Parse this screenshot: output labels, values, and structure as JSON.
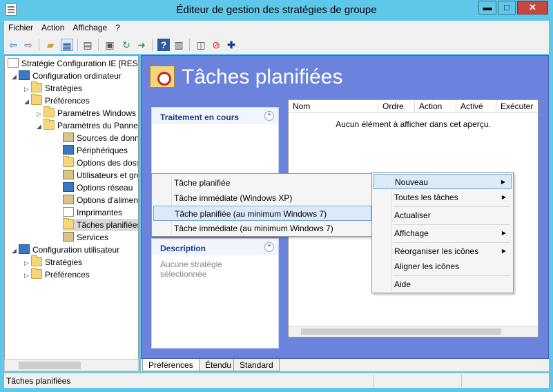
{
  "window": {
    "title": "Éditeur de gestion des stratégies de groupe",
    "minimize": "▬",
    "maximize": "□",
    "close": "✕"
  },
  "menubar": [
    "Fichier",
    "Action",
    "Affichage",
    "?"
  ],
  "toolbar_icons": [
    "back-icon",
    "forward-icon",
    "up-folder-icon",
    "show-hide-tree-icon",
    "properties-icon",
    "print-icon",
    "refresh-icon",
    "export-icon",
    "help-icon",
    "view-icon",
    "new-icon",
    "stop-icon",
    "add-icon"
  ],
  "tree": {
    "root": "Stratégie Configuration IE [RES-",
    "computer_config": "Configuration ordinateur",
    "strategies": "Stratégies",
    "preferences": "Préférences",
    "windows_params": "Paramètres Windows",
    "panel_params": "Paramètres du Panne",
    "data_sources": "Sources de donn",
    "devices": "Périphériques",
    "folder_options": "Options des doss",
    "users_groups": "Utilisateurs et gro",
    "network_options": "Options réseau",
    "power_options": "Options d'alimen",
    "printers": "Imprimantes",
    "scheduled_tasks": "Tâches planifiées",
    "services": "Services",
    "user_config": "Configuration utilisateur",
    "user_strategies": "Stratégies",
    "user_preferences": "Préférences"
  },
  "main": {
    "title": "Tâches planifiées",
    "panel1_header": "Traitement en cours",
    "panel2_header": "Description",
    "panel2_body": "Aucune stratégie sélectionnée",
    "columns": [
      "Nom",
      "Ordre",
      "Action",
      "Activé",
      "Exécuter"
    ],
    "empty_text": "Aucun élément à afficher dans cet aperçu."
  },
  "submenu": [
    "Tâche planifiée",
    "Tâche immédiate (Windows XP)",
    "Tâche planifiée (au minimum Windows 7)",
    "Tâche immédiate (au minimum Windows 7)"
  ],
  "context_menu": [
    "Nouveau",
    "Toutes les tâches",
    "Actualiser",
    "Affichage",
    "Réorganiser les icônes",
    "Aligner les icônes",
    "Aide"
  ],
  "tabs": [
    "Préférences",
    "Étendu",
    "Standard"
  ],
  "status": "Tâches planifiées"
}
